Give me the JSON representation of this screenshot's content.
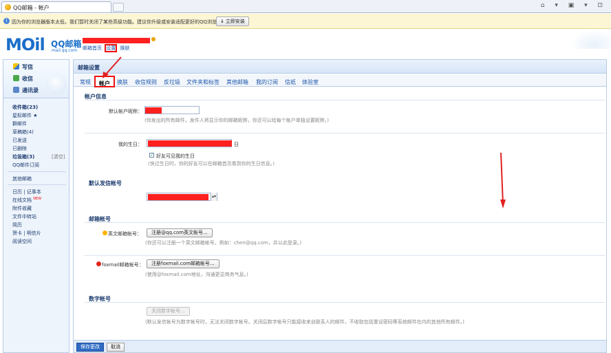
{
  "browser": {
    "tab_title": "QQ邮箱 - 帐户",
    "toolbar_icons": "⌂ ▾ ▣ ▾ ⊡"
  },
  "infobar": {
    "message": "因为你的浏览器版本太低，我们暂时关闭了某些高级功能。建议你升级或安装适配更好的QQ浏览器。",
    "install_label": "立即安装"
  },
  "header": {
    "logo_text": "MOil",
    "logo_brand": "QQ邮箱",
    "logo_domain": "mail.qq.com",
    "nav": {
      "home": "邮箱首页",
      "settings": "设置",
      "skin": "换肤"
    }
  },
  "sidebar": {
    "compose": "写信",
    "inbox": "收信",
    "contacts": "通讯录",
    "folders": [
      {
        "label": "收件箱(23)",
        "bold": true
      },
      {
        "label": "星标邮件 ★",
        "bold": false
      },
      {
        "label": "群邮件",
        "bold": false
      },
      {
        "label": "草稿箱(4)",
        "bold": false
      },
      {
        "label": "已发送",
        "bold": false
      },
      {
        "label": "已删除",
        "bold": false
      },
      {
        "label": "垃圾箱(3)",
        "bold": true
      },
      {
        "label": "QQ邮件订阅",
        "bold": false
      }
    ],
    "clear_label": "[清空]",
    "other_mail": "其他邮箱",
    "tools": [
      {
        "label": "日历 | 记事本"
      },
      {
        "label": "在线文档"
      },
      {
        "label": "附件收藏"
      },
      {
        "label": "文件中转站"
      },
      {
        "label": "简历"
      },
      {
        "label": "贺卡 | 明信片"
      },
      {
        "label": "阅读空间"
      }
    ],
    "new_badge": "NEW"
  },
  "main": {
    "title": "邮箱设置",
    "tabs": [
      "常规",
      "帐户",
      "换肤",
      "收信规则",
      "反垃圾",
      "文件夹和标签",
      "其他邮箱",
      "我的订阅",
      "信纸",
      "体验室"
    ],
    "active_tab": "帐户",
    "account_info": {
      "heading": "帐户信息",
      "nickname_label": "默认帐户昵称：",
      "nickname_hint": "(你发出的所有邮件，发件人将显示你的邮箱昵称，你还可以给每个帐户单独设置昵称。)",
      "birthday_label": "我的生日：",
      "birthday_day_suffix": "日",
      "birthday_visible": "好友可见我的生日",
      "birthday_hint": "(快过生日时，你的好友可以在邮箱首页看到你的生日信息。)"
    },
    "default_sender": {
      "heading": "默认发信帐号"
    },
    "mail_accounts": {
      "heading": "邮箱帐号",
      "english_label": "英文邮箱帐号：",
      "english_btn": "注册@qq.com英文帐号...",
      "english_hint": "(你还可以注册一个英文邮箱帐号，例如：chen@qq.com，并以此登录。)",
      "foxmail_label": "foxmail邮箱帐号：",
      "foxmail_btn": "注册foxmail.com邮箱帐号...",
      "foxmail_hint": "(使用@foxmail.com地址，沟通更显商务气息。)"
    },
    "digital_account": {
      "heading": "数字帐号",
      "close_btn": "关闭数字帐号...",
      "hint": "(默认发信帐号为数字帐号时，无法关闭数字帐号。关闭后数字帐号只能接收来自联系人的邮件，不收取包括重设密码等系统邮件在内的其他所有邮件。)"
    },
    "buttons": {
      "save": "保存更改",
      "cancel": "取消"
    }
  },
  "colors": {
    "accent": "#1b6fc9",
    "highlight_red": "#e11111"
  }
}
